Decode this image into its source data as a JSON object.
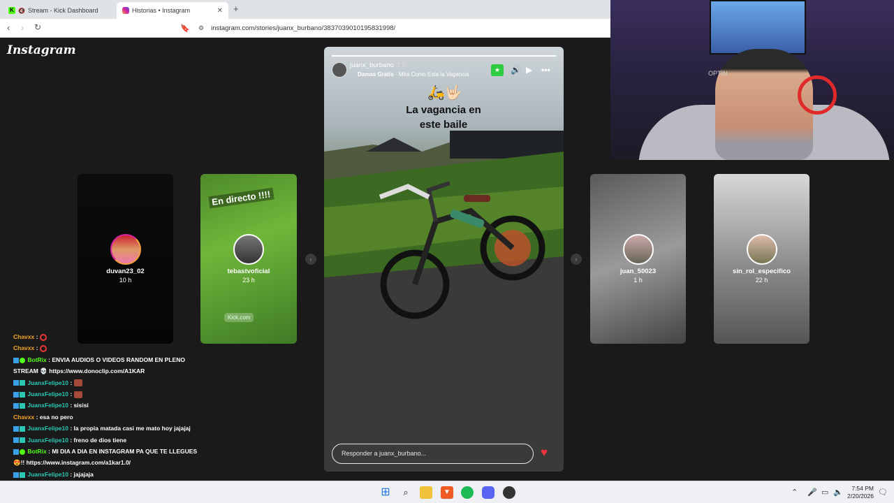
{
  "browser": {
    "tabs": [
      {
        "title": "Stream - Kick Dashboard",
        "active": false
      },
      {
        "title": "Historias • Instagram",
        "active": true
      }
    ],
    "new_tab": "+",
    "url": "instagram.com/stories/juanx_burbano/3837039010195831998/"
  },
  "instagram": {
    "logo": "Instagram",
    "side_stories": [
      {
        "username": "duvan23_02",
        "time": "10 h"
      },
      {
        "username": "tebastvoficial",
        "time": "23 h",
        "overlay_top": "En directo !!!!",
        "overlay_bottom": "Kick.com"
      },
      {
        "username": "juan_50023",
        "time": "1 h"
      },
      {
        "username": "sin_rol_especifico",
        "time": "22 h"
      }
    ],
    "main_story": {
      "username": "juanx_burbano",
      "time": "1 h",
      "music_artist": "Damas Gratis",
      "music_title": "Mira Como Esta la Vagancia",
      "caption_line1": "La vagancia en",
      "caption_line2": "este baile",
      "progress": 1.0,
      "reply_placeholder": "Responder a juanx_burbano..."
    }
  },
  "chat": {
    "messages": [
      {
        "user": "Chavxx",
        "text": "",
        "color": "#f5a623",
        "badges": 0,
        "emote": "ring"
      },
      {
        "user": "Chavxx",
        "text": "",
        "color": "#f5a623",
        "badges": 0,
        "emote": "ring"
      },
      {
        "user": "BotRix",
        "text": "ENVIA AUDIOS O VIDEOS RANDOM EN PLENO STREAM 💀 https://www.donoclip.com/A1KAR",
        "color": "#53fc18",
        "badges": 2
      },
      {
        "user": "JuanxFelipe10",
        "text": "",
        "color": "#2bc7b4",
        "badges": 2,
        "emote": "square"
      },
      {
        "user": "JuanxFelipe10",
        "text": "",
        "color": "#2bc7b4",
        "badges": 2,
        "emote": "square"
      },
      {
        "user": "JuanxFelipe10",
        "text": "sisisi",
        "color": "#2bc7b4",
        "badges": 2
      },
      {
        "user": "Chavxx",
        "text": "esa no pero",
        "color": "#f5a623",
        "badges": 0
      },
      {
        "user": "JuanxFelipe10",
        "text": "la propia matada casi me mato hoy jajajaj",
        "color": "#2bc7b4",
        "badges": 2
      },
      {
        "user": "JuanxFelipe10",
        "text": "freno de dios tiene",
        "color": "#2bc7b4",
        "badges": 2
      },
      {
        "user": "BotRix",
        "text": "MI DIA A DIA EN INSTAGRAM PA QUE TE LLEGUES 😍!! https://www.instagram.com/a1kar1.0/",
        "color": "#53fc18",
        "badges": 2
      },
      {
        "user": "JuanxFelipe10",
        "text": "jajajaja",
        "color": "#2bc7b4",
        "badges": 2
      }
    ]
  },
  "webcam": {
    "watermark": "OPTIN"
  },
  "taskbar": {
    "clock_time": "7:54 PM",
    "clock_date": "2/20/2026"
  }
}
